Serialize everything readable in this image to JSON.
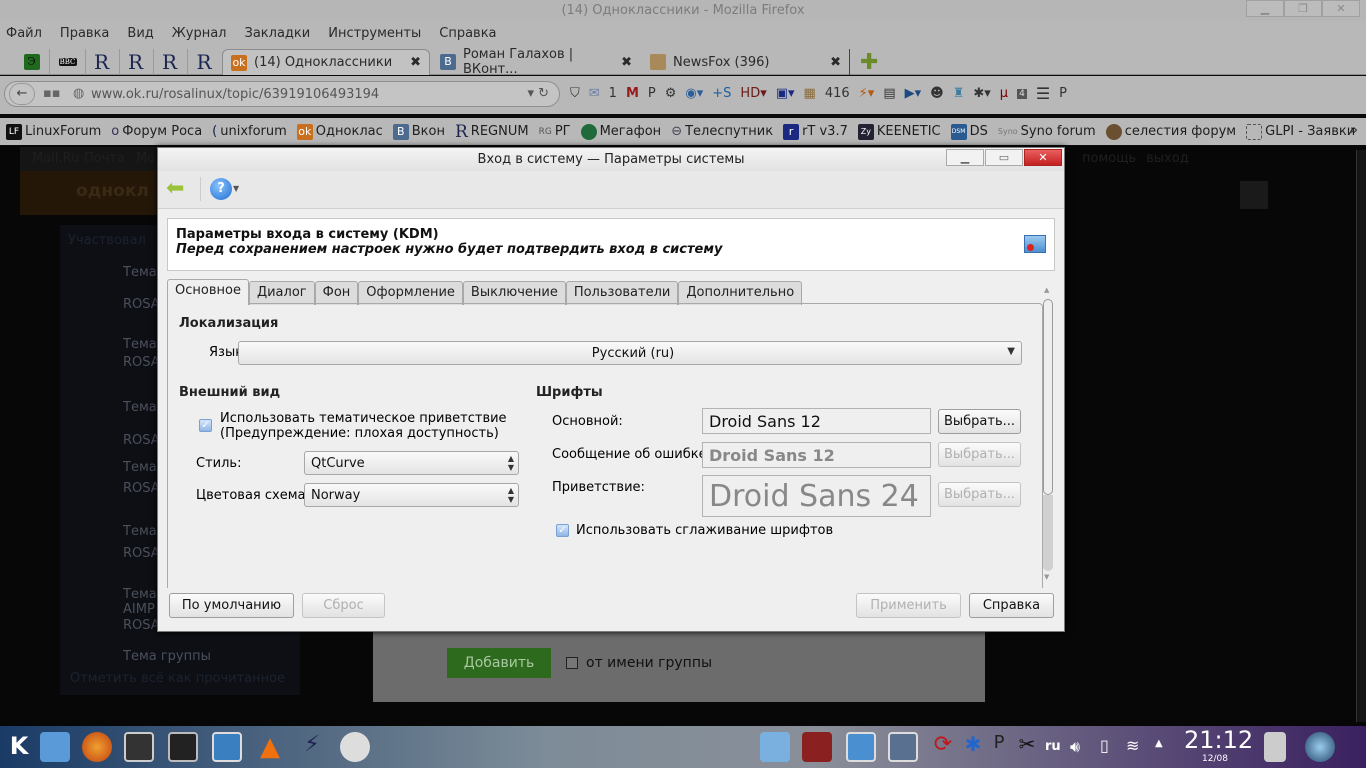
{
  "firefox": {
    "title": "(14) Одноклассники - Mozilla Firefox",
    "menu": [
      "Файл",
      "Правка",
      "Вид",
      "Журнал",
      "Закладки",
      "Инструменты",
      "Справка"
    ],
    "tabs": [
      {
        "label": "(14) Одноклассники",
        "selected": true
      },
      {
        "label": "Роман Галахов | ВКонт...",
        "selected": false
      },
      {
        "label": "NewsFox (396)",
        "selected": false
      }
    ],
    "url": "www.ok.ru/rosalinux/topic/63919106493194",
    "toolbar": {
      "mail_count": "1",
      "counter": "416",
      "ublock_badge": "4"
    },
    "bookmarks": [
      "LinuxForum",
      "Форум Роса",
      "unixforum",
      "Одноклас",
      "Вкон",
      "REGNUM",
      "РГ",
      "Мегафон",
      "Телеспутник",
      "rT v3.7",
      "KEENETIC",
      "DS",
      "Syno forum",
      "селестия форум",
      "GLPI - Заявки"
    ]
  },
  "background_page": {
    "top_links": [
      "Mail.Ru",
      "Почта",
      "Мо"
    ],
    "right_links": [
      "помощь",
      "выход"
    ],
    "logo": "однокл",
    "filter": "Участвовал",
    "topics": [
      "Тема",
      "Тема",
      "Тема",
      "Тема",
      "Тема",
      "Тема",
      "Тема группы"
    ],
    "topic_sub": [
      "ROSA",
      "ROSA",
      "ROSA",
      "ROSA",
      "ROSA",
      "AIMP",
      "ROSA"
    ],
    "mark_read": "Отметить всё как прочитанное",
    "add_button": "Добавить",
    "as_group": "от имени группы"
  },
  "dialog": {
    "title": "Вход в систему — Параметры системы",
    "header_title": "Параметры входа в систему (KDM)",
    "header_subtitle": "Перед сохранением настроек нужно будет подтвердить вход в систему",
    "tabs": [
      "Основное",
      "Диалог",
      "Фон",
      "Оформление",
      "Выключение",
      "Пользователи",
      "Дополнительно"
    ],
    "localization": {
      "heading": "Локализация",
      "language_label": "Язык:",
      "language_value": "Русский (ru)"
    },
    "appearance": {
      "heading": "Внешний вид",
      "themed_greeter": "Использовать тематическое приветствие",
      "themed_greeter_note": "(Предупреждение: плохая доступность)",
      "themed_checked": true,
      "style_label": "Стиль:",
      "style_value": "QtCurve",
      "scheme_label": "Цветовая схема:",
      "scheme_value": "Norway"
    },
    "fonts": {
      "heading": "Шрифты",
      "general_label": "Основной:",
      "general_value": "Droid Sans 12",
      "failure_label": "Сообщение об ошибке:",
      "failure_value": "Droid Sans 12",
      "greeting_label": "Приветствие:",
      "greeting_value": "Droid Sans 24",
      "choose": "Выбрать...",
      "antialias": "Использовать сглаживание шрифтов",
      "antialias_checked": true
    },
    "buttons": {
      "defaults": "По умолчанию",
      "reset": "Сброс",
      "apply": "Применить",
      "help": "Справка"
    }
  },
  "taskbar": {
    "lang": "ru",
    "time": "21:12",
    "date": "12/08"
  }
}
